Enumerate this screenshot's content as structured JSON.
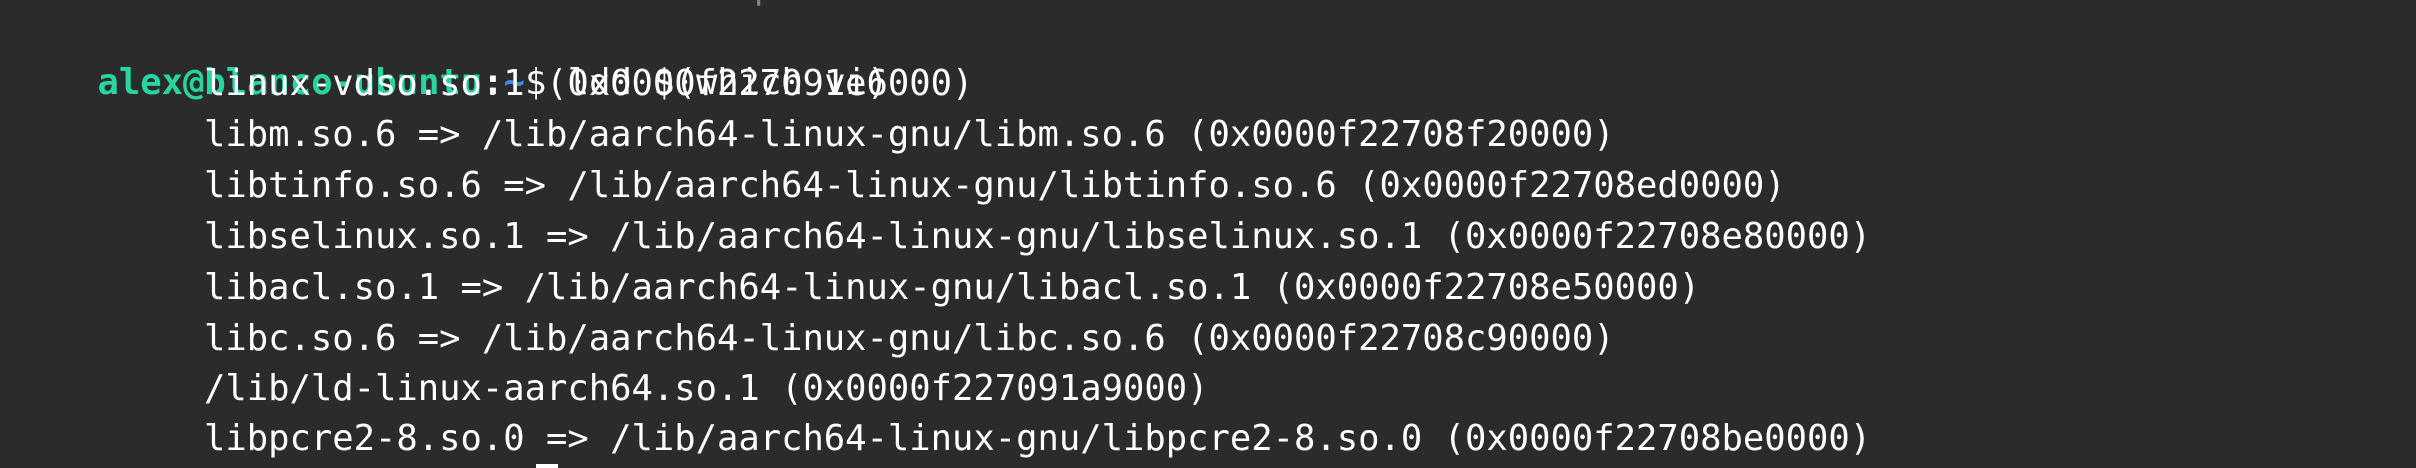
{
  "terminal": {
    "top_fragment": "                    .              |                          .                              .",
    "prompt": {
      "user_host": "alex@blanco-ubuntu",
      "separator": ":",
      "path": "~",
      "symbol": "$ ",
      "command": "ldd $(which vi)"
    },
    "output_lines": [
      "linux-vdso.so.1 (0x0000f227091e6000)",
      "libm.so.6 => /lib/aarch64-linux-gnu/libm.so.6 (0x0000f22708f20000)",
      "libtinfo.so.6 => /lib/aarch64-linux-gnu/libtinfo.so.6 (0x0000f22708ed0000)",
      "libselinux.so.1 => /lib/aarch64-linux-gnu/libselinux.so.1 (0x0000f22708e80000)",
      "libacl.so.1 => /lib/aarch64-linux-gnu/libacl.so.1 (0x0000f22708e50000)",
      "libc.so.6 => /lib/aarch64-linux-gnu/libc.so.6 (0x0000f22708c90000)",
      "/lib/ld-linux-aarch64.so.1 (0x0000f227091a9000)",
      "libpcre2-8.so.0 => /lib/aarch64-linux-gnu/libpcre2-8.so.0 (0x0000f22708be0000)"
    ],
    "colors": {
      "background": "#2b2b2b",
      "text": "#ffffff",
      "user_host": "#26d5a0",
      "path": "#3b8eea"
    }
  }
}
